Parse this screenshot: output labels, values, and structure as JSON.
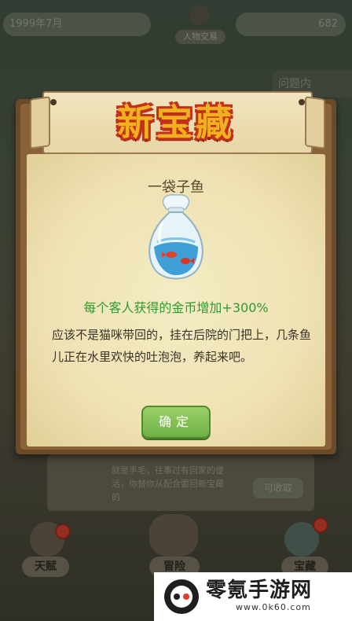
{
  "background": {
    "date_text": "1999年7月",
    "coins_text": "682",
    "avatar_label": "人物交易",
    "right_tab_label": "问题内",
    "bottom_panel": {
      "text": "就是手毛，往事过有回家的便活，你替你从配合要回新宝藏的",
      "button_label": "可收取"
    },
    "nav": [
      {
        "label": "天赋",
        "icon": "paw-icon",
        "badge": true
      },
      {
        "label": "冒险",
        "icon": "cats-icon",
        "badge": true
      },
      {
        "label": "宝藏",
        "icon": "treasure-bag-icon",
        "badge": true
      }
    ]
  },
  "dialog": {
    "title": "新宝藏",
    "item_name": "一袋子鱼",
    "item_icon": "fish-bag-icon",
    "effect": "每个客人获得的金币增加+300%",
    "description": "应该不是猫咪带回的，挂在后院的门把上，几条鱼儿正在水里欢快的吐泡泡，养起来吧。",
    "confirm_label": "确定"
  },
  "watermark": {
    "name": "零氪手游网",
    "url": "www.0k60.com"
  },
  "colors": {
    "title_fill": "#f0b020",
    "title_outline": "#c0301a",
    "effect_text": "#2f9a2f",
    "button": "#7fbf52"
  }
}
